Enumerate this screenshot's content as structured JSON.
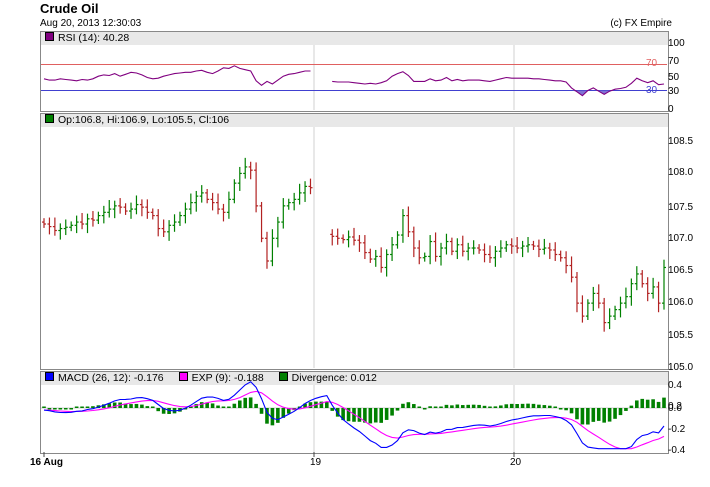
{
  "header": {
    "title": "Crude Oil",
    "timestamp": "Aug 20, 2013 12:30:03",
    "credit": "(c) FX Empire"
  },
  "rsi_panel": {
    "legend": "RSI (14): 40.28",
    "legend_color": "#800080",
    "ticks": [
      "100",
      "70",
      "50",
      "30",
      "0"
    ],
    "overbought": 70,
    "oversold": 30,
    "overbought_label": "70",
    "oversold_label": "30"
  },
  "price_panel": {
    "legend": "Op:106.8, Hi:106.9, Lo:105.5, Cl:106",
    "legend_color": "#008000",
    "ticks": [
      "108.5",
      "108.0",
      "107.5",
      "107.0",
      "106.5",
      "106.0",
      "105.5",
      "105.0"
    ]
  },
  "macd_panel": {
    "legend_macd": "MACD (26, 12): -0.176",
    "legend_exp": "EXP (9): -0.188",
    "legend_div": "Divergence: 0.012",
    "ticks": [
      "0.4",
      "0.2",
      "0.0",
      "-0.2",
      "-0.4"
    ]
  },
  "x_axis": {
    "labels": [
      "16 Aug",
      "19",
      "20"
    ]
  },
  "colors": {
    "up": "#008000",
    "down": "#b22222",
    "rsi": "#800080",
    "overbought_line": "#e06060",
    "oversold_line": "#4040d0",
    "macd": "#0000ff",
    "exp": "#ff00ff",
    "divergence": "#008000",
    "header_bg": "#e8e8e8"
  },
  "chart_data": {
    "type": "ohlc",
    "ohlc_close": [
      107.22,
      107.18,
      107.12,
      107.15,
      107.17,
      107.2,
      107.25,
      107.22,
      107.3,
      107.28,
      107.35,
      107.4,
      107.45,
      107.5,
      107.48,
      107.42,
      107.45,
      107.52,
      107.48,
      107.4,
      107.35,
      107.15,
      107.1,
      107.2,
      107.25,
      107.35,
      107.45,
      107.55,
      107.65,
      107.7,
      107.6,
      107.55,
      107.45,
      107.4,
      107.6,
      107.85,
      108.0,
      108.1,
      108.05,
      107.5,
      107.0,
      106.65,
      107.0,
      107.25,
      107.5,
      107.55,
      107.6,
      107.7,
      107.8,
      107.78,
      null,
      null,
      null,
      107.03,
      107.0,
      106.98,
      107.02,
      106.97,
      106.93,
      106.78,
      106.68,
      106.72,
      106.55,
      106.75,
      106.9,
      107.05,
      107.35,
      107.1,
      106.85,
      106.7,
      106.72,
      106.95,
      106.72,
      106.85,
      106.95,
      106.8,
      106.9,
      106.8,
      106.85,
      106.85,
      106.82,
      106.75,
      106.7,
      106.8,
      106.85,
      106.9,
      106.88,
      106.85,
      106.88,
      106.9,
      106.88,
      106.83,
      106.85,
      106.82,
      106.75,
      106.7,
      106.58,
      106.4,
      106.0,
      105.8,
      106.0,
      106.15,
      106.0,
      105.7,
      105.8,
      105.9,
      106.0,
      106.1,
      106.3,
      106.45,
      106.3,
      106.15,
      106.25,
      106.0,
      106.55
    ],
    "x_labels": [
      "16 Aug",
      "19",
      "20"
    ],
    "rsi": {
      "name": "RSI (14)",
      "last": 40.28,
      "range": [
        0,
        100
      ],
      "levels": [
        70,
        30
      ],
      "values": [
        48,
        46,
        46,
        48,
        47,
        46,
        45,
        47,
        46,
        48,
        52,
        54,
        53,
        56,
        52,
        55,
        58,
        57,
        54,
        50,
        48,
        49,
        52,
        54,
        56,
        57,
        58,
        58,
        60,
        61,
        58,
        56,
        60,
        65,
        64,
        68,
        64,
        62,
        60,
        45,
        38,
        44,
        40,
        46,
        52,
        55,
        56,
        58,
        60,
        60,
        null,
        null,
        null,
        44,
        43,
        43,
        43,
        42,
        41,
        40,
        41,
        40,
        42,
        45,
        52,
        56,
        59,
        53,
        44,
        44,
        44,
        48,
        45,
        46,
        50,
        45,
        47,
        45,
        46,
        46,
        46,
        45,
        44,
        46,
        48,
        50,
        49,
        49,
        49,
        49,
        48,
        48,
        47,
        46,
        45,
        45,
        43,
        34,
        28,
        22,
        30,
        34,
        29,
        24,
        29,
        32,
        33,
        35,
        41,
        49,
        45,
        42,
        45,
        39,
        40
      ]
    },
    "macd": {
      "range": [
        -0.4,
        0.4
      ],
      "series": [
        {
          "name": "MACD (26, 12)",
          "last": -0.176
        },
        {
          "name": "EXP (9)",
          "last": -0.188
        },
        {
          "name": "Divergence",
          "last": 0.012
        }
      ]
    }
  }
}
